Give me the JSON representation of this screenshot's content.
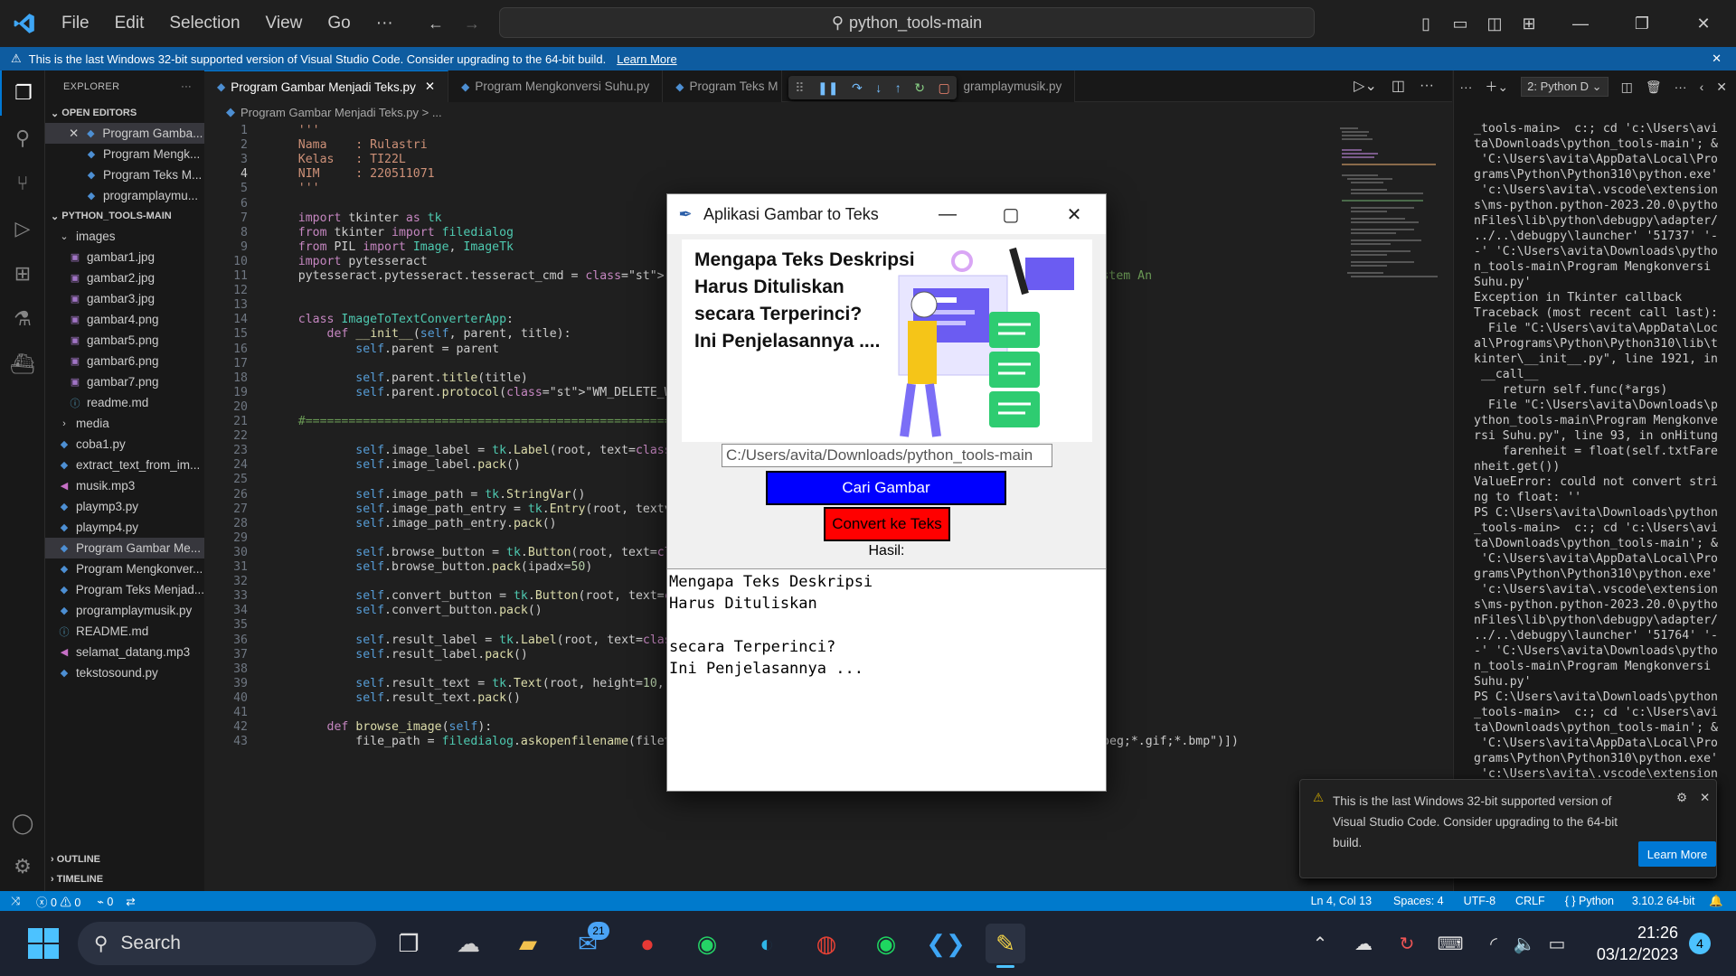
{
  "window": {
    "search": "python_tools-main",
    "menus": [
      "File",
      "Edit",
      "Selection",
      "View",
      "Go",
      "···"
    ]
  },
  "banner": {
    "text": "This is the last Windows 32-bit supported version of Visual Studio Code. Consider upgrading to the 64-bit build.",
    "link": "Learn More"
  },
  "explorer": {
    "title": "EXPLORER",
    "open_editors": "OPEN EDITORS",
    "project": "PYTHON_TOOLS-MAIN",
    "outline": "OUTLINE",
    "timeline": "TIMELINE",
    "open": [
      "Program Gamba...",
      "Program Mengk...",
      "Program Teks M...",
      "programplaymu..."
    ],
    "tree": [
      {
        "n": "images",
        "t": "folder"
      },
      {
        "n": "gambar1.jpg",
        "t": "img"
      },
      {
        "n": "gambar2.jpg",
        "t": "img"
      },
      {
        "n": "gambar3.jpg",
        "t": "img"
      },
      {
        "n": "gambar4.png",
        "t": "img"
      },
      {
        "n": "gambar5.png",
        "t": "img"
      },
      {
        "n": "gambar6.png",
        "t": "img"
      },
      {
        "n": "gambar7.png",
        "t": "img"
      },
      {
        "n": "readme.md",
        "t": "md"
      },
      {
        "n": "media",
        "t": "folder2"
      },
      {
        "n": "coba1.py",
        "t": "py"
      },
      {
        "n": "extract_text_from_im...",
        "t": "py"
      },
      {
        "n": "musik.mp3",
        "t": "mp3"
      },
      {
        "n": "playmp3.py",
        "t": "py"
      },
      {
        "n": "playmp4.py",
        "t": "py"
      },
      {
        "n": "Program Gambar Me...",
        "t": "py"
      },
      {
        "n": "Program Mengkonver...",
        "t": "py"
      },
      {
        "n": "Program Teks Menjad...",
        "t": "py"
      },
      {
        "n": "programplaymusik.py",
        "t": "py"
      },
      {
        "n": "README.md",
        "t": "md"
      },
      {
        "n": "selamat_datang.mp3",
        "t": "mp3"
      },
      {
        "n": "tekstosound.py",
        "t": "py"
      }
    ]
  },
  "tabs": [
    "Program Gambar Menjadi Teks.py",
    "Program Mengkonversi Suhu.py",
    "Program Teks M",
    "gramplaymusik.py"
  ],
  "breadcrumb": "Program Gambar Menjadi Teks.py > ...",
  "code": [
    "    '''",
    "    Nama    : Rulastri",
    "    Kelas   : TI22L",
    "    NIM     : 220511071",
    "    '''",
    "",
    "    import tkinter as tk",
    "    from tkinter import filedialog",
    "    from PIL import Image, ImageTk",
    "    import pytesseract",
    "    pytesseract.pytesseract.tesseract_cmd = r'C:\\Program Fi",
    "",
    "",
    "    class ImageToTextConverterApp:",
    "        def __init__(self, parent, title):",
    "            self.parent = parent",
    "",
    "            self.parent.title(title)",
    "            self.parent.protocol(\"WM_DELETE_WINDOW\", self.c",
    "",
    "    #=============================================================",
    "",
    "            self.image_label = tk.Label(root, text=\"Gambar:",
    "            self.image_label.pack()",
    "",
    "            self.image_path = tk.StringVar()",
    "            self.image_path_entry = tk.Entry(root, textvari",
    "            self.image_path_entry.pack()",
    "",
    "            self.browse_button = tk.Button(root, text=\"Cari",
    "            self.browse_button.pack(ipadx=50)",
    "",
    "            self.convert_button = tk.Button(root, text=\"Con",
    "            self.convert_button.pack()",
    "",
    "            self.result_label = tk.Label(root, text=\"Hasil:",
    "            self.result_label.pack()",
    "",
    "            self.result_text = tk.Text(root, height=10, width=40)",
    "            self.result_text.pack()",
    "",
    "        def browse_image(self):",
    "            file_path = filedialog.askopenfilename(filetypes=[(\"Image files\", \"*.png;*.jpg;*.jpeg;*.gif;*.bmp\")])"
  ],
  "code_tail": {
    "line11": "instalasi Tesseract di sistem An",
    "line30": ")",
    "line33": "image)"
  },
  "panel": {
    "terminal_select": "2: Python D"
  },
  "terminal": "_tools-main>  c:; cd 'c:\\Users\\avi\nta\\Downloads\\python_tools-main'; &\n 'C:\\Users\\avita\\AppData\\Local\\Pro\ngrams\\Python\\Python310\\python.exe'\n 'c:\\Users\\avita\\.vscode\\extension\ns\\ms-python.python-2023.20.0\\pytho\nnFiles\\lib\\python\\debugpy\\adapter/\n../..\\debugpy\\launcher' '51737' '-\n-' 'C:\\Users\\avita\\Downloads\\pytho\nn_tools-main\\Program Mengkonversi\nSuhu.py'\nException in Tkinter callback\nTraceback (most recent call last):\n  File \"C:\\Users\\avita\\AppData\\Loc\nal\\Programs\\Python\\Python310\\lib\\t\nkinter\\__init__.py\", line 1921, in\n __call__\n    return self.func(*args)\n  File \"C:\\Users\\avita\\Downloads\\p\nython_tools-main\\Program Mengkonve\nrsi Suhu.py\", line 93, in onHitung\n    farenheit = float(self.txtFare\nnheit.get())\nValueError: could not convert stri\nng to float: ''\nPS C:\\Users\\avita\\Downloads\\python\n_tools-main>  c:; cd 'c:\\Users\\avi\nta\\Downloads\\python_tools-main'; &\n 'C:\\Users\\avita\\AppData\\Local\\Pro\ngrams\\Python\\Python310\\python.exe'\n 'c:\\Users\\avita\\.vscode\\extension\ns\\ms-python.python-2023.20.0\\pytho\nnFiles\\lib\\python\\debugpy\\adapter/\n../..\\debugpy\\launcher' '51764' '-\n-' 'C:\\Users\\avita\\Downloads\\pytho\nn_tools-main\\Program Mengkonversi\nSuhu.py'\nPS C:\\Users\\avita\\Downloads\\python\n_tools-main>  c:; cd 'c:\\Users\\avi\nta\\Downloads\\python_tools-main'; &\n 'C:\\Users\\avita\\AppData\\Local\\Pro\ngrams\\Python\\Python310\\python.exe'\n 'c:\\Users\\avita\\.vscode\\extension",
  "notification": {
    "text": "This is the last Windows 32-bit supported version of Visual Studio Code. Consider upgrading to the 64-bit build.",
    "button": "Learn More"
  },
  "status": {
    "errors": "0",
    "warnings": "0",
    "ports": "0",
    "position": "Ln 4, Col 13",
    "spaces": "Spaces: 4",
    "encoding": "UTF-8",
    "eol": "CRLF",
    "language": "Python",
    "interpreter": "3.10.2 64-bit"
  },
  "tkapp": {
    "title": "Aplikasi Gambar to Teks",
    "image_text": [
      "Mengapa Teks Deskripsi",
      "Harus Dituliskan",
      "secara Terperinci?",
      "Ini Penjelasannya ...."
    ],
    "path": "C:/Users/avita/Downloads/python_tools-main",
    "browse": "Cari Gambar",
    "convert": "Convert ke Teks",
    "result_label": "Hasil:",
    "result": "Mengapa Teks Deskripsi\nHarus Dituliskan\n\nsecara Terperinci?\nIni Penjelasannya ..."
  },
  "taskbar": {
    "search": "Search",
    "mail_badge": "21",
    "time": "21:26",
    "date": "03/12/2023",
    "notif_count": "4"
  }
}
